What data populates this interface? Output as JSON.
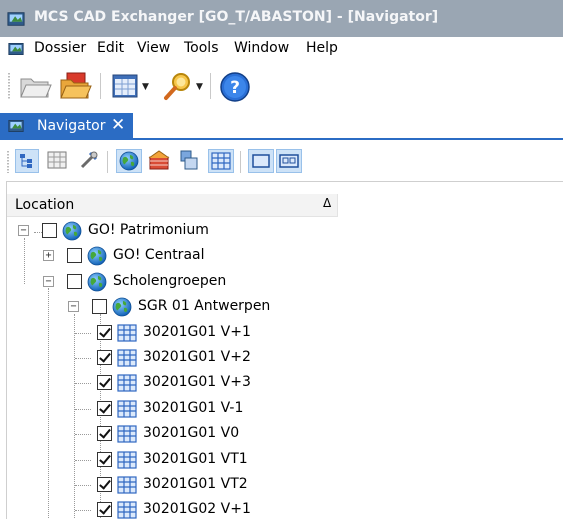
{
  "window": {
    "title": "MCS CAD Exchanger [GO_T/ABASTON] - [Navigator]"
  },
  "menu": {
    "items": [
      "Dossier",
      "Edit",
      "View",
      "Tools",
      "Window",
      "Help"
    ]
  },
  "toolbar": {
    "buttons": [
      "open-folder-icon",
      "folder-icon",
      "table-view-icon",
      "search-icon",
      "help-icon"
    ]
  },
  "tab": {
    "label": "Navigator",
    "close": "✕"
  },
  "nav_toolbar": {
    "buttons": [
      "tree-view-icon",
      "grid-view-icon",
      "tools-icon",
      "globe-icon",
      "building-icon",
      "export-icon",
      "floor-plan-icon",
      "rectangle-icon",
      "dual-view-icon"
    ]
  },
  "tree": {
    "column_header": "Location",
    "sort_indicator": "Δ",
    "nodes": [
      {
        "label": "GO! Patrimonium",
        "level": 0,
        "expander": "−",
        "checked": false,
        "icon": "globe-icon"
      },
      {
        "label": "GO! Centraal",
        "level": 1,
        "expander": "+",
        "checked": false,
        "icon": "globe-icon"
      },
      {
        "label": "Scholengroepen",
        "level": 1,
        "expander": "−",
        "checked": false,
        "icon": "globe-icon"
      },
      {
        "label": "SGR 01 Antwerpen",
        "level": 2,
        "expander": "−",
        "checked": false,
        "icon": "globe-icon"
      },
      {
        "label": "30201G01 V+1",
        "level": 3,
        "checked": true,
        "icon": "floor-plan-icon"
      },
      {
        "label": "30201G01 V+2",
        "level": 3,
        "checked": true,
        "icon": "floor-plan-icon"
      },
      {
        "label": "30201G01 V+3",
        "level": 3,
        "checked": true,
        "icon": "floor-plan-icon"
      },
      {
        "label": "30201G01 V-1",
        "level": 3,
        "checked": true,
        "icon": "floor-plan-icon"
      },
      {
        "label": "30201G01 V0",
        "level": 3,
        "checked": true,
        "icon": "floor-plan-icon"
      },
      {
        "label": "30201G01 VT1",
        "level": 3,
        "checked": true,
        "icon": "floor-plan-icon"
      },
      {
        "label": "30201G01 VT2",
        "level": 3,
        "checked": true,
        "icon": "floor-plan-icon"
      },
      {
        "label": "30201G02 V+1",
        "level": 3,
        "checked": true,
        "icon": "floor-plan-icon"
      }
    ]
  },
  "colors": {
    "titlebar": "#9aa6b3",
    "accent": "#2b6cc4"
  }
}
